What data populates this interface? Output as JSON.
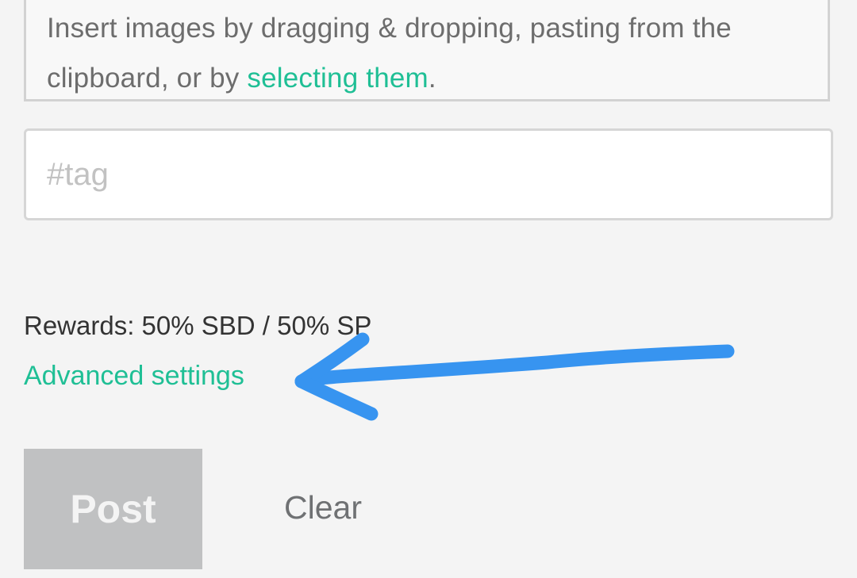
{
  "dropzone": {
    "text_before": "Insert images by dragging & dropping, pasting from the clipboard, or by ",
    "link_text": "selecting them",
    "text_after": "."
  },
  "tags": {
    "placeholder": "#tag",
    "value": ""
  },
  "rewards": {
    "text": "Rewards: 50% SBD / 50% SP"
  },
  "advanced_settings": {
    "label": "Advanced settings"
  },
  "actions": {
    "post_label": "Post",
    "clear_label": "Clear"
  },
  "colors": {
    "accent": "#1fbf95",
    "annotation_arrow": "#3794f0",
    "post_disabled_bg": "#c0c1c2"
  },
  "annotation": {
    "icon": "hand-drawn-arrow-icon"
  }
}
